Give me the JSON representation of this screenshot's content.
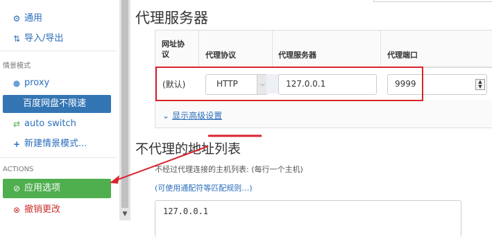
{
  "sidebar": {
    "items": [
      {
        "label": "通用",
        "icon": "gear-icon"
      },
      {
        "label": "导入/导出",
        "icon": "import-export-icon"
      }
    ],
    "section_profiles": "情景模式",
    "profiles": [
      {
        "label": "proxy",
        "icon": "globe-icon",
        "color": "#6aa2d8"
      },
      {
        "label": "百度网盘不限速",
        "icon": "",
        "selected": true
      },
      {
        "label": "auto switch",
        "icon": "switch-icon",
        "color": "#4fae4e"
      },
      {
        "label": "新建情景模式...",
        "icon": "plus-icon"
      }
    ],
    "section_actions": "ACTIONS",
    "actions": [
      {
        "label": "应用选项",
        "icon": "check-circle-icon",
        "color": "#4fae4e"
      },
      {
        "label": "撤销更改",
        "icon": "x-circle-icon",
        "color": "#c9302c"
      }
    ]
  },
  "main": {
    "title": "代理服务器",
    "table": {
      "headers": [
        "网址协\n议",
        "代理协议",
        "代理服务器",
        "代理端口"
      ],
      "row": {
        "scheme": "(默认)",
        "protocol": "HTTP",
        "server": "127.0.0.1",
        "port": "9999"
      }
    },
    "advanced_link": "显示高级设置",
    "bypass_title": "不代理的地址列表",
    "bypass_desc": "不经过代理连接的主机列表: (每行一个主机)",
    "bypass_link": "(可使用通配符等匹配规则…)",
    "bypass_value": "127.0.0.1"
  },
  "colors": {
    "accent": "#3475b3",
    "apply": "#4fae4e",
    "annotation": "#d9232d"
  }
}
